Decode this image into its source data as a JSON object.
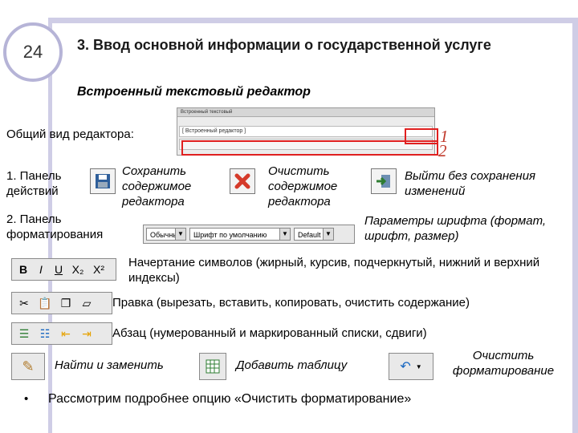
{
  "slide": {
    "number": "24",
    "title": "3. Ввод основной информации о государственной услуге",
    "subtitle": "Встроенный текстовый редактор",
    "general_view_label": "Общий вид редактора:",
    "marker_1": "1",
    "marker_2": "2"
  },
  "editor_preview": {
    "window_title": "Встроенный текстовый",
    "content_row": "[ Встроенный редактор ]"
  },
  "panel_actions": {
    "label": "1. Панель действий",
    "save": "Сохранить содержимое редактора",
    "clear": "Очистить содержимое редактора",
    "exit": "Выйти без сохранения изменений"
  },
  "panel_format": {
    "label": "2. Панель форматирования",
    "font_params": "Параметры шрифта (формат, шрифт, размер)",
    "selects": [
      "Обычный",
      "Шрифт по умолчанию",
      "Default"
    ]
  },
  "rows": {
    "char_style_buttons": [
      "B",
      "I",
      "U",
      "X₂",
      "X²"
    ],
    "char_style_desc": "Начертание символов (жирный, курсив, подчеркнутый, нижний и верхний индексы)",
    "edit_desc": "Правка (вырезать, вставить, копировать, очистить содержание)",
    "para_desc": "Абзац (нумерованный и маркированный списки, сдвиги)",
    "find_replace": "Найти и заменить",
    "add_table": "Добавить таблицу",
    "clear_format": "Очистить форматирование"
  },
  "bullet": {
    "glyph": "•",
    "text": "Рассмотрим подробнее опцию «Очистить форматирование»"
  }
}
